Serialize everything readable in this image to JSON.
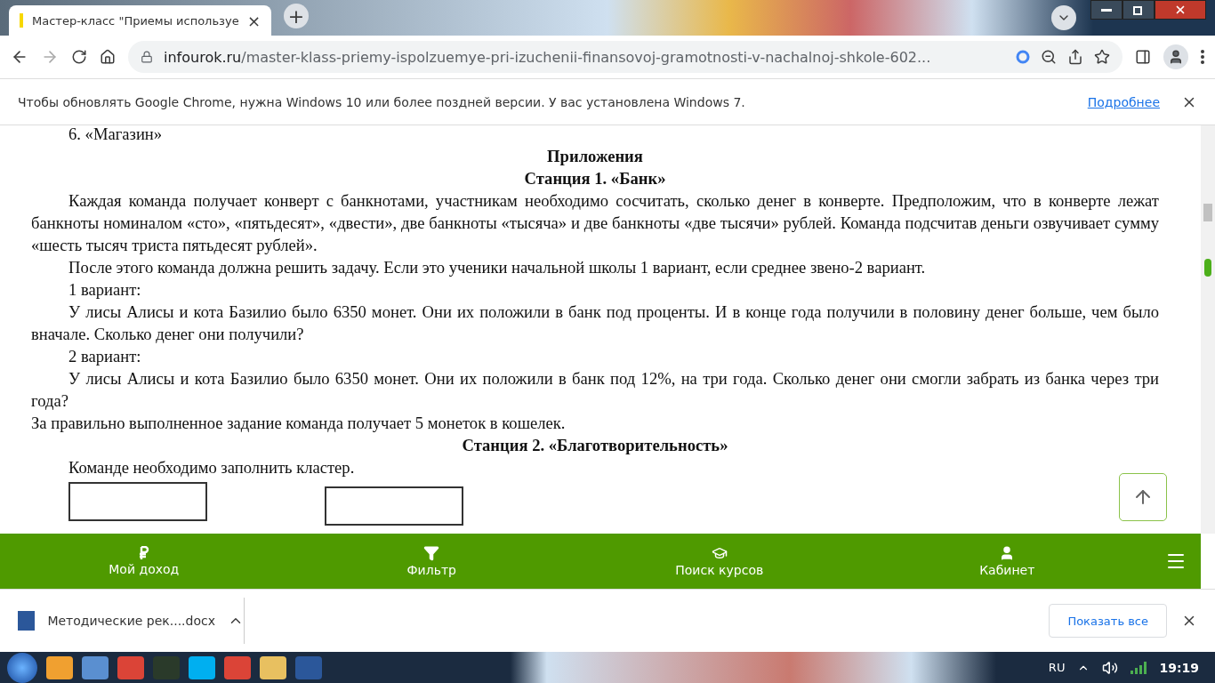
{
  "tab": {
    "title": "Мастер-класс \"Приемы используе",
    "close": "×",
    "new_tab": "+"
  },
  "address": {
    "host": "infourok.ru",
    "path": "/master-klass-priemy-ispolzuemye-pri-izuchenii-finansovoj-gramotnosti-v-nachalnoj-shkole-602..."
  },
  "infobar": {
    "text": "Чтобы обновлять Google Chrome, нужна Windows 10 или более поздней версии. У вас установлена Windows 7.",
    "link": "Подробнее"
  },
  "document": [
    {
      "kind": "indent",
      "text": "6. «Магазин»"
    },
    {
      "kind": "heading",
      "text": "Приложения"
    },
    {
      "kind": "heading",
      "text": "Станция 1. «Банк»"
    },
    {
      "kind": "indent",
      "text": "Каждая команда получает конверт с банкнотами, участникам необходимо сосчитать, сколько денег в конверте. Предположим, что в конверте лежат банкноты номиналом «сто», «пятьдесят», «двести», две банкноты  «тысяча» и две банкноты «две тысячи» рублей. Команда подсчитав деньги озвучивает сумму «шесть тысяч триста пятьдесят рублей»."
    },
    {
      "kind": "indent",
      "text": "После этого команда должна решить задачу. Если это ученики начальной школы 1 вариант, если среднее звено-2 вариант."
    },
    {
      "kind": "indent",
      "text": "1 вариант:"
    },
    {
      "kind": "indent",
      "text": "У лисы Алисы и кота Базилио было 6350 монет. Они их положили в банк под проценты. И в конце года получили в половину денег больше, чем было вначале. Сколько денег они получили?"
    },
    {
      "kind": "indent",
      "text": "2 вариант:"
    },
    {
      "kind": "indent",
      "text": "У лисы Алисы и кота Базилио было 6350 монет. Они их положили в банк под 12%, на три года. Сколько денег они смогли забрать из банка через три года?"
    },
    {
      "kind": "plain",
      "text": "За правильно выполненное задание команда получает 5 монеток в кошелек."
    },
    {
      "kind": "heading",
      "text": "Станция 2. «Благотворительность»"
    },
    {
      "kind": "indent",
      "text": "Команде необходимо заполнить кластер."
    }
  ],
  "bottom_nav": [
    {
      "kind": "ruble",
      "label": "Мой доход"
    },
    {
      "kind": "filter",
      "label": "Фильтр"
    },
    {
      "kind": "cap",
      "label": "Поиск курсов"
    },
    {
      "kind": "user",
      "label": "Кабинет"
    }
  ],
  "download": {
    "file": "Методические рек....docx",
    "show_all": "Показать все"
  },
  "taskbar": {
    "language": "RU",
    "time": "19:19"
  }
}
